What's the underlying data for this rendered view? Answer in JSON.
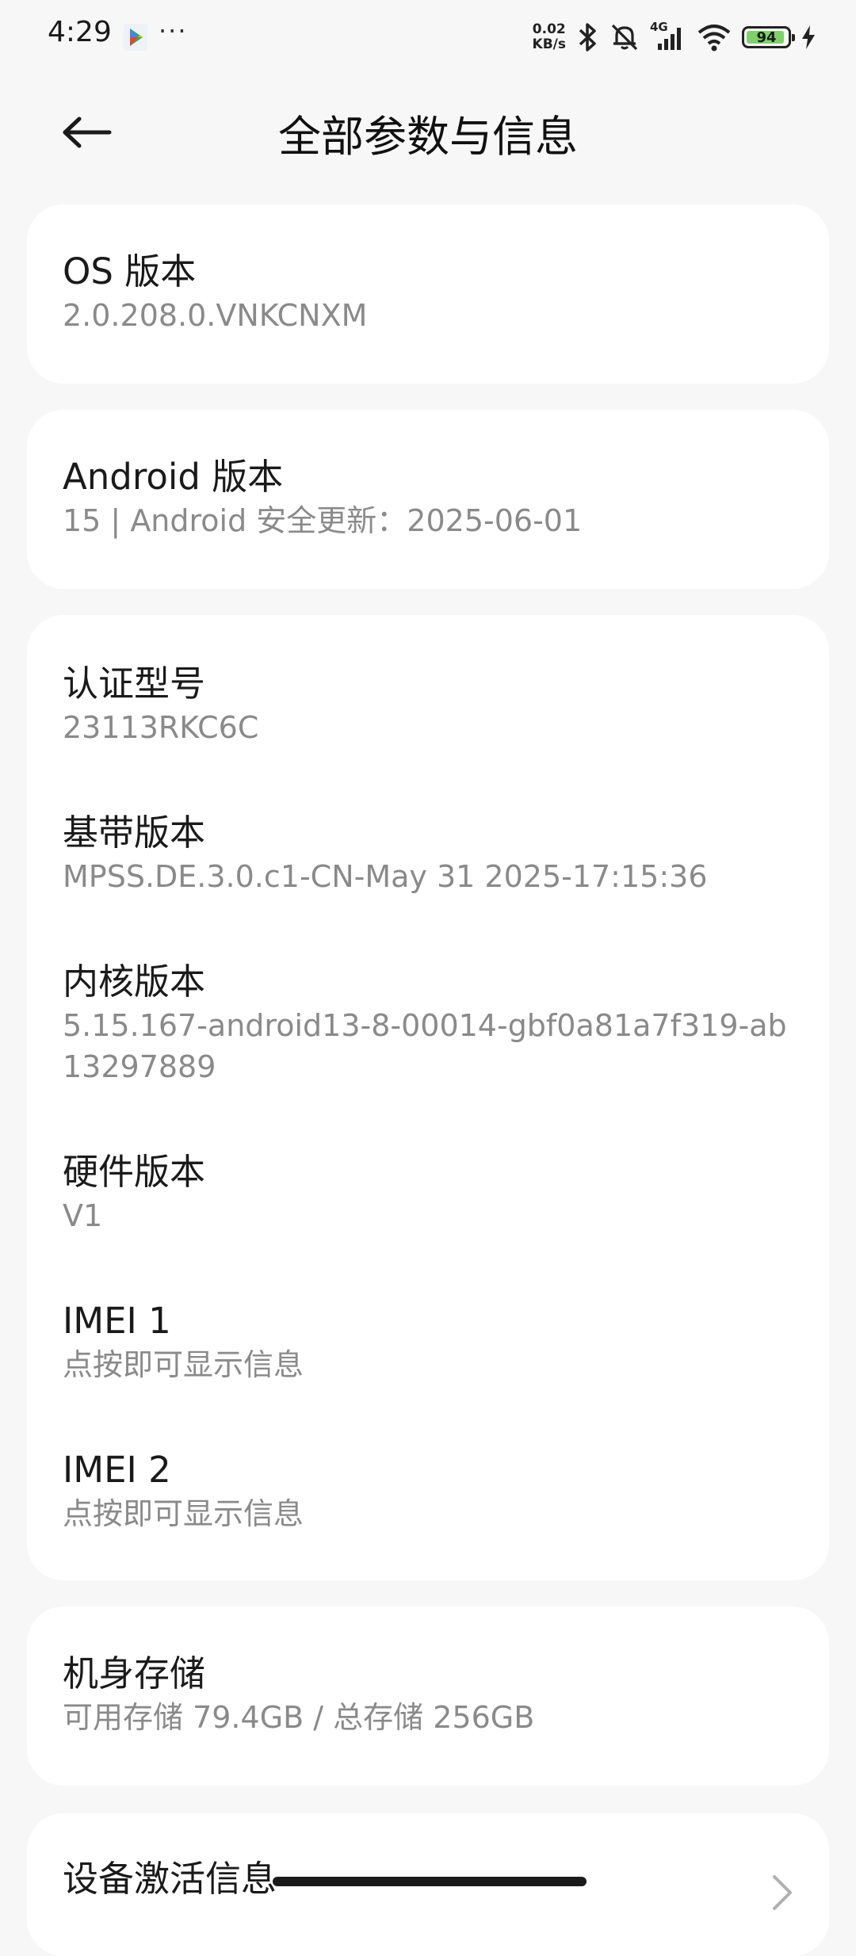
{
  "status_bar": {
    "time": "4:29",
    "more": "···",
    "net_speed_value": "0.02",
    "net_speed_unit": "KB/s",
    "network_type": "4G",
    "battery_level": "94",
    "battery_fraction": 0.94,
    "battery_color": "#7ed16a",
    "icons": [
      "play-store-icon",
      "bluetooth-icon",
      "ringer-off-icon",
      "signal-icon",
      "wifi-icon",
      "battery-icon",
      "charging-icon"
    ]
  },
  "header": {
    "title": "全部参数与信息",
    "back_icon": "back-arrow-icon"
  },
  "cards": {
    "os": {
      "title": "OS 版本",
      "value": "2.0.208.0.VNKCNXM"
    },
    "android": {
      "title": "Android 版本",
      "value": "15 | Android 安全更新：2025-06-01"
    },
    "details": {
      "model_title": "认证型号",
      "model_value": "23113RKC6C",
      "baseband_title": "基带版本",
      "baseband_value": "MPSS.DE.3.0.c1-CN-May 31 2025-17:15:36",
      "kernel_title": "内核版本",
      "kernel_value": "5.15.167-android13-8-00014-gbf0a81a7f319-ab13297889",
      "hardware_title": "硬件版本",
      "hardware_value": "V1",
      "imei1_title": "IMEI 1",
      "imei1_value": "点按即可显示信息",
      "imei2_title": "IMEI 2",
      "imei2_value": "点按即可显示信息"
    },
    "storage": {
      "title": "机身存储",
      "value": "可用存储 79.4GB / 总存储 256GB"
    },
    "activation": {
      "title": "设备激活信息"
    }
  },
  "colors": {
    "background": "#f7f7f7",
    "card": "#ffffff",
    "primary_text": "#1a1a1a",
    "secondary_text": "#8a8a8a"
  }
}
